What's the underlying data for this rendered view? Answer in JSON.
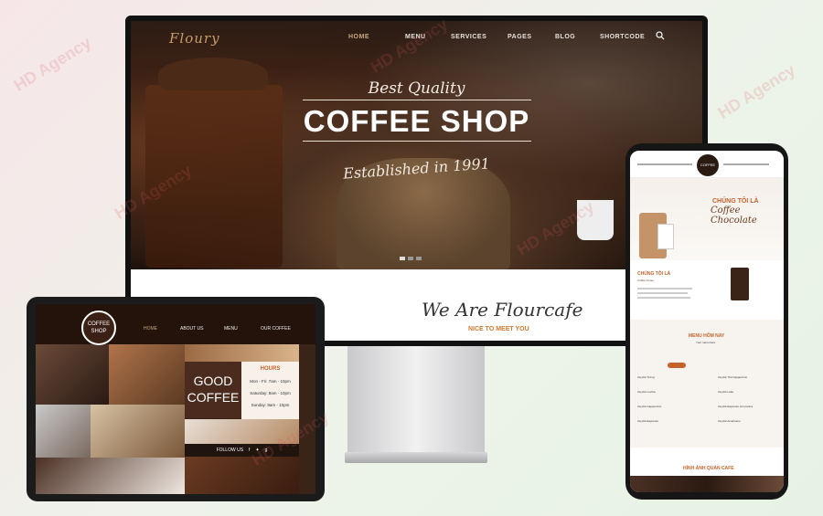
{
  "monitor": {
    "logo": "Floury",
    "nav": [
      "HOME",
      "MENU",
      "SERVICES",
      "PAGES",
      "BLOG",
      "SHORTCODE"
    ],
    "active_nav": "HOME",
    "hero": {
      "tagline": "Best Quality",
      "title": "COFFEE SHOP",
      "established": "Established in 1991"
    },
    "lower": {
      "title": "We Are Flourcafe",
      "subtitle": "NICE TO MEET YOU"
    }
  },
  "tablet": {
    "logo_line1": "COFFEE",
    "logo_line2": "SHOP",
    "nav": [
      "HOME",
      "ABOUT US",
      "MENU",
      "OUR COFFEE"
    ],
    "good_coffee_1": "GOOD",
    "good_coffee_2": "COFFEE",
    "hours_title": "HOURS",
    "hours": [
      "Mon - Fri: 7am - 10pm",
      "Saturday: 8am - 10pm",
      "Sunday: 8am - 10pm"
    ],
    "follow": "FOLLOW US"
  },
  "phone": {
    "logo": "COFFEE",
    "hero_small": "CHÚNG TÔI LÀ",
    "hero_script": "Coffee Chocolate",
    "about_title": "CHÚNG TÔI LÀ",
    "about_script": "Coffee house",
    "menu_title": "MENU HÔM NAY",
    "menu_sub": "Your menu here",
    "menu_left": [
      "Cà phê Trứng",
      "Cà phê mocha",
      "Cà phê Cappuccino",
      "Cà phê Espresso"
    ],
    "menu_right": [
      "Cà phê Trái Cappuccino",
      "Cà phê Latte",
      "Cà phê Espresso con panna",
      "Cà phê Americano"
    ],
    "gallery_title": "HÌNH ẢNH QUÁN CAFE"
  },
  "colors": {
    "accent": "#c8622b",
    "brand_brown": "#3a2418",
    "gold": "#c9a680"
  }
}
